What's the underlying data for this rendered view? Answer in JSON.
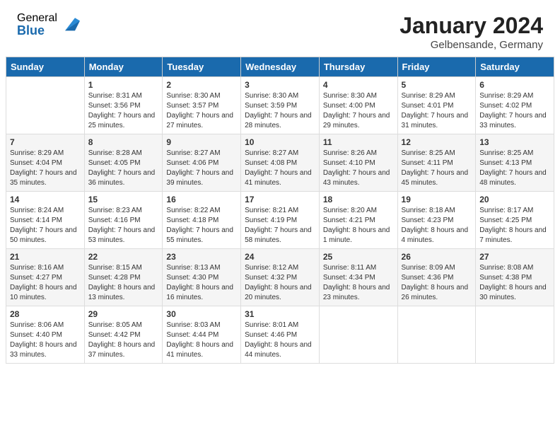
{
  "logo": {
    "general": "General",
    "blue": "Blue"
  },
  "title": "January 2024",
  "location": "Gelbensande, Germany",
  "days_of_week": [
    "Sunday",
    "Monday",
    "Tuesday",
    "Wednesday",
    "Thursday",
    "Friday",
    "Saturday"
  ],
  "weeks": [
    [
      {
        "day": "",
        "sunrise": "",
        "sunset": "",
        "daylight": ""
      },
      {
        "day": "1",
        "sunrise": "Sunrise: 8:31 AM",
        "sunset": "Sunset: 3:56 PM",
        "daylight": "Daylight: 7 hours and 25 minutes."
      },
      {
        "day": "2",
        "sunrise": "Sunrise: 8:30 AM",
        "sunset": "Sunset: 3:57 PM",
        "daylight": "Daylight: 7 hours and 27 minutes."
      },
      {
        "day": "3",
        "sunrise": "Sunrise: 8:30 AM",
        "sunset": "Sunset: 3:59 PM",
        "daylight": "Daylight: 7 hours and 28 minutes."
      },
      {
        "day": "4",
        "sunrise": "Sunrise: 8:30 AM",
        "sunset": "Sunset: 4:00 PM",
        "daylight": "Daylight: 7 hours and 29 minutes."
      },
      {
        "day": "5",
        "sunrise": "Sunrise: 8:29 AM",
        "sunset": "Sunset: 4:01 PM",
        "daylight": "Daylight: 7 hours and 31 minutes."
      },
      {
        "day": "6",
        "sunrise": "Sunrise: 8:29 AM",
        "sunset": "Sunset: 4:02 PM",
        "daylight": "Daylight: 7 hours and 33 minutes."
      }
    ],
    [
      {
        "day": "7",
        "sunrise": "Sunrise: 8:29 AM",
        "sunset": "Sunset: 4:04 PM",
        "daylight": "Daylight: 7 hours and 35 minutes."
      },
      {
        "day": "8",
        "sunrise": "Sunrise: 8:28 AM",
        "sunset": "Sunset: 4:05 PM",
        "daylight": "Daylight: 7 hours and 36 minutes."
      },
      {
        "day": "9",
        "sunrise": "Sunrise: 8:27 AM",
        "sunset": "Sunset: 4:06 PM",
        "daylight": "Daylight: 7 hours and 39 minutes."
      },
      {
        "day": "10",
        "sunrise": "Sunrise: 8:27 AM",
        "sunset": "Sunset: 4:08 PM",
        "daylight": "Daylight: 7 hours and 41 minutes."
      },
      {
        "day": "11",
        "sunrise": "Sunrise: 8:26 AM",
        "sunset": "Sunset: 4:10 PM",
        "daylight": "Daylight: 7 hours and 43 minutes."
      },
      {
        "day": "12",
        "sunrise": "Sunrise: 8:25 AM",
        "sunset": "Sunset: 4:11 PM",
        "daylight": "Daylight: 7 hours and 45 minutes."
      },
      {
        "day": "13",
        "sunrise": "Sunrise: 8:25 AM",
        "sunset": "Sunset: 4:13 PM",
        "daylight": "Daylight: 7 hours and 48 minutes."
      }
    ],
    [
      {
        "day": "14",
        "sunrise": "Sunrise: 8:24 AM",
        "sunset": "Sunset: 4:14 PM",
        "daylight": "Daylight: 7 hours and 50 minutes."
      },
      {
        "day": "15",
        "sunrise": "Sunrise: 8:23 AM",
        "sunset": "Sunset: 4:16 PM",
        "daylight": "Daylight: 7 hours and 53 minutes."
      },
      {
        "day": "16",
        "sunrise": "Sunrise: 8:22 AM",
        "sunset": "Sunset: 4:18 PM",
        "daylight": "Daylight: 7 hours and 55 minutes."
      },
      {
        "day": "17",
        "sunrise": "Sunrise: 8:21 AM",
        "sunset": "Sunset: 4:19 PM",
        "daylight": "Daylight: 7 hours and 58 minutes."
      },
      {
        "day": "18",
        "sunrise": "Sunrise: 8:20 AM",
        "sunset": "Sunset: 4:21 PM",
        "daylight": "Daylight: 8 hours and 1 minute."
      },
      {
        "day": "19",
        "sunrise": "Sunrise: 8:18 AM",
        "sunset": "Sunset: 4:23 PM",
        "daylight": "Daylight: 8 hours and 4 minutes."
      },
      {
        "day": "20",
        "sunrise": "Sunrise: 8:17 AM",
        "sunset": "Sunset: 4:25 PM",
        "daylight": "Daylight: 8 hours and 7 minutes."
      }
    ],
    [
      {
        "day": "21",
        "sunrise": "Sunrise: 8:16 AM",
        "sunset": "Sunset: 4:27 PM",
        "daylight": "Daylight: 8 hours and 10 minutes."
      },
      {
        "day": "22",
        "sunrise": "Sunrise: 8:15 AM",
        "sunset": "Sunset: 4:28 PM",
        "daylight": "Daylight: 8 hours and 13 minutes."
      },
      {
        "day": "23",
        "sunrise": "Sunrise: 8:13 AM",
        "sunset": "Sunset: 4:30 PM",
        "daylight": "Daylight: 8 hours and 16 minutes."
      },
      {
        "day": "24",
        "sunrise": "Sunrise: 8:12 AM",
        "sunset": "Sunset: 4:32 PM",
        "daylight": "Daylight: 8 hours and 20 minutes."
      },
      {
        "day": "25",
        "sunrise": "Sunrise: 8:11 AM",
        "sunset": "Sunset: 4:34 PM",
        "daylight": "Daylight: 8 hours and 23 minutes."
      },
      {
        "day": "26",
        "sunrise": "Sunrise: 8:09 AM",
        "sunset": "Sunset: 4:36 PM",
        "daylight": "Daylight: 8 hours and 26 minutes."
      },
      {
        "day": "27",
        "sunrise": "Sunrise: 8:08 AM",
        "sunset": "Sunset: 4:38 PM",
        "daylight": "Daylight: 8 hours and 30 minutes."
      }
    ],
    [
      {
        "day": "28",
        "sunrise": "Sunrise: 8:06 AM",
        "sunset": "Sunset: 4:40 PM",
        "daylight": "Daylight: 8 hours and 33 minutes."
      },
      {
        "day": "29",
        "sunrise": "Sunrise: 8:05 AM",
        "sunset": "Sunset: 4:42 PM",
        "daylight": "Daylight: 8 hours and 37 minutes."
      },
      {
        "day": "30",
        "sunrise": "Sunrise: 8:03 AM",
        "sunset": "Sunset: 4:44 PM",
        "daylight": "Daylight: 8 hours and 41 minutes."
      },
      {
        "day": "31",
        "sunrise": "Sunrise: 8:01 AM",
        "sunset": "Sunset: 4:46 PM",
        "daylight": "Daylight: 8 hours and 44 minutes."
      },
      {
        "day": "",
        "sunrise": "",
        "sunset": "",
        "daylight": ""
      },
      {
        "day": "",
        "sunrise": "",
        "sunset": "",
        "daylight": ""
      },
      {
        "day": "",
        "sunrise": "",
        "sunset": "",
        "daylight": ""
      }
    ]
  ]
}
